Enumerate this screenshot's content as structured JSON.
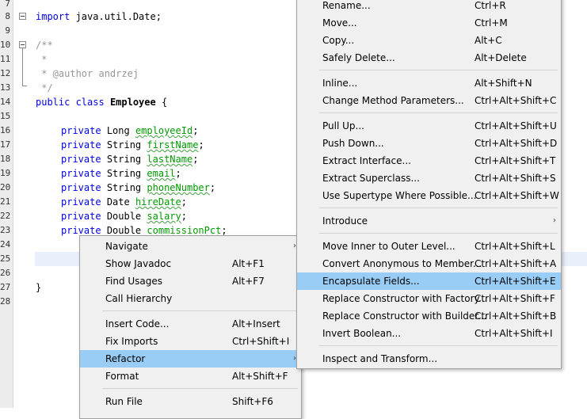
{
  "editor": {
    "line_numbers": [
      "7",
      "8",
      "9",
      "10",
      "11",
      "12",
      "13",
      "14",
      "15",
      "16",
      "17",
      "18",
      "19",
      "20",
      "21",
      "22",
      "23",
      "24",
      "25",
      "26",
      "27",
      "28"
    ],
    "lines": {
      "l8": {
        "kw": "import",
        "rest": " java.util.Date;"
      },
      "l10": "/**",
      "l11": " *",
      "l12": " * @author andrzej",
      "l13": " */",
      "l14": {
        "kw": "public class",
        "name": "Employee",
        "rest": " {"
      },
      "fields": [
        {
          "kw": "private",
          "type": "Long",
          "name": "employeeId"
        },
        {
          "kw": "private",
          "type": "String",
          "name": "firstName"
        },
        {
          "kw": "private",
          "type": "String",
          "name": "lastName"
        },
        {
          "kw": "private",
          "type": "String",
          "name": "email"
        },
        {
          "kw": "private",
          "type": "String",
          "name": "phoneNumber"
        },
        {
          "kw": "private",
          "type": "Date",
          "name": "hireDate"
        },
        {
          "kw": "private",
          "type": "Double",
          "name": "salary"
        },
        {
          "kw": "private",
          "type": "Double",
          "name": "commissionPct"
        }
      ],
      "l27": "}"
    }
  },
  "context_menu": {
    "items": [
      {
        "label": "Navigate",
        "shortcut": "",
        "submenu": true
      },
      {
        "label": "Show Javadoc",
        "shortcut": "Alt+F1"
      },
      {
        "label": "Find Usages",
        "shortcut": "Alt+F7"
      },
      {
        "label": "Call Hierarchy",
        "shortcut": ""
      },
      {
        "label": "Insert Code...",
        "shortcut": "Alt+Insert"
      },
      {
        "label": "Fix Imports",
        "shortcut": "Ctrl+Shift+I"
      },
      {
        "label": "Refactor",
        "shortcut": "",
        "submenu": true,
        "highlighted": true
      },
      {
        "label": "Format",
        "shortcut": "Alt+Shift+F"
      },
      {
        "label": "Run File",
        "shortcut": "Shift+F6"
      }
    ]
  },
  "refactor_menu": {
    "items": [
      {
        "label": "Rename...",
        "shortcut": "Ctrl+R"
      },
      {
        "label": "Move...",
        "shortcut": "Ctrl+M"
      },
      {
        "label": "Copy...",
        "shortcut": "Alt+C"
      },
      {
        "label": "Safely Delete...",
        "shortcut": "Alt+Delete"
      },
      {
        "label": "Inline...",
        "shortcut": "Alt+Shift+N"
      },
      {
        "label": "Change Method Parameters...",
        "shortcut": "Ctrl+Alt+Shift+C"
      },
      {
        "label": "Pull Up...",
        "shortcut": "Ctrl+Alt+Shift+U"
      },
      {
        "label": "Push Down...",
        "shortcut": "Ctrl+Alt+Shift+D"
      },
      {
        "label": "Extract Interface...",
        "shortcut": "Ctrl+Alt+Shift+T"
      },
      {
        "label": "Extract Superclass...",
        "shortcut": "Ctrl+Alt+Shift+S"
      },
      {
        "label": "Use Supertype Where Possible...",
        "shortcut": "Ctrl+Alt+Shift+W"
      },
      {
        "label": "Introduce",
        "shortcut": "",
        "submenu": true
      },
      {
        "label": "Move Inner to Outer Level...",
        "shortcut": "Ctrl+Alt+Shift+L"
      },
      {
        "label": "Convert Anonymous to Member...",
        "shortcut": "Ctrl+Alt+Shift+A"
      },
      {
        "label": "Encapsulate Fields...",
        "shortcut": "Ctrl+Alt+Shift+E",
        "highlighted": true
      },
      {
        "label": "Replace Constructor with Factory...",
        "shortcut": "Ctrl+Alt+Shift+F"
      },
      {
        "label": "Replace Constructor with Builder...",
        "shortcut": "Ctrl+Alt+Shift+B"
      },
      {
        "label": "Invert Boolean...",
        "shortcut": "Ctrl+Alt+Shift+I"
      },
      {
        "label": "Inspect and Transform...",
        "shortcut": ""
      }
    ]
  }
}
